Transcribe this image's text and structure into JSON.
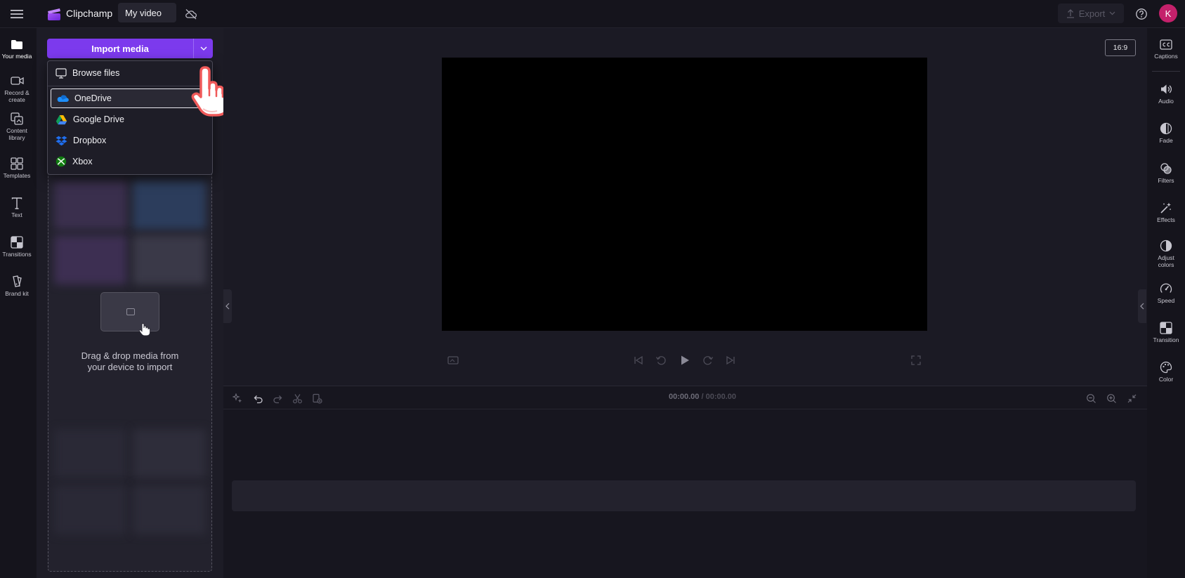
{
  "app": {
    "name": "Clipchamp",
    "project_name": "My video"
  },
  "topbar": {
    "export_label": "Export",
    "avatar_initial": "K"
  },
  "leftnav": {
    "items": [
      {
        "label": "Your media",
        "icon": "folder-icon"
      },
      {
        "label": "Record & create",
        "icon": "camera-icon"
      },
      {
        "label": "Content library",
        "icon": "library-icon"
      },
      {
        "label": "Templates",
        "icon": "templates-icon"
      },
      {
        "label": "Text",
        "icon": "text-icon"
      },
      {
        "label": "Transitions",
        "icon": "transitions-icon"
      },
      {
        "label": "Brand kit",
        "icon": "brand-kit-icon"
      }
    ]
  },
  "media": {
    "import_label": "Import media",
    "dropzone_text_line1": "Drag & drop media from",
    "dropzone_text_line2": "your device to import"
  },
  "import_menu": {
    "items": [
      {
        "label": "Browse files",
        "icon": "monitor-icon"
      },
      {
        "label": "OneDrive",
        "icon": "onedrive-icon",
        "selected": true
      },
      {
        "label": "Google Drive",
        "icon": "google-drive-icon"
      },
      {
        "label": "Dropbox",
        "icon": "dropbox-icon"
      },
      {
        "label": "Xbox",
        "icon": "xbox-icon"
      }
    ]
  },
  "preview": {
    "aspect_ratio": "16:9"
  },
  "timeline": {
    "current_time": "00:00.00",
    "separator": "/",
    "duration": "00:00.00"
  },
  "rightpanel": {
    "items": [
      {
        "label": "Captions",
        "icon": "captions-icon"
      },
      {
        "label": "Audio",
        "icon": "speaker-icon"
      },
      {
        "label": "Fade",
        "icon": "fade-icon"
      },
      {
        "label": "Filters",
        "icon": "filters-icon"
      },
      {
        "label": "Effects",
        "icon": "effects-wand-icon"
      },
      {
        "label": "Adjust colors",
        "icon": "adjust-colors-icon"
      },
      {
        "label": "Speed",
        "icon": "speed-icon"
      },
      {
        "label": "Transition",
        "icon": "transition-icon"
      },
      {
        "label": "Color",
        "icon": "palette-icon"
      }
    ]
  },
  "colors": {
    "accent": "#7c3aed",
    "avatar": "#c4216b",
    "background": "#1b1a24"
  }
}
